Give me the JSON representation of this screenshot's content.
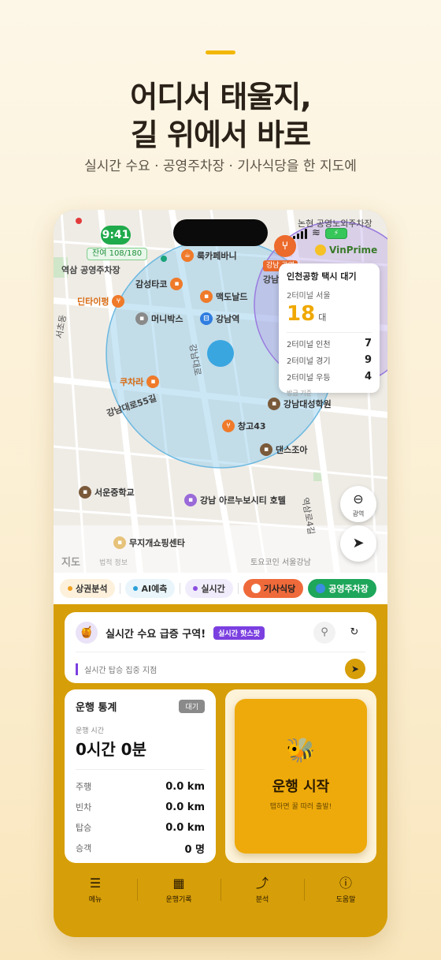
{
  "hero": {
    "title_line1": "어디서 태울지,",
    "title_line2": "길 위에서 바로",
    "subtitle": "실시간 수요 · 공영주차장 · 기사식당을 한 지도에"
  },
  "status": {
    "time": "9:41",
    "top_right_label": "논현 공영노외주차장",
    "battery_icon": "battery-charging-icon",
    "parking_badge": "잔여 108/180"
  },
  "map": {
    "labels": {
      "yeoksam_parking": "역삼 공영주차장",
      "rook_cafe": "룩카페바니",
      "gamsung_taco": "감성타코",
      "mcdonalds": "맥도날드",
      "dintaifung": "딘타이펑",
      "moneybox": "머니박스",
      "gangnam_station": "강남역",
      "gangnam_daero": "강남대로",
      "kucharra": "쿠차라",
      "gangnam_daero_55": "강남대로55길",
      "changgo43": "창고43",
      "dance_jo": "댄스조아",
      "gangnam_academy": "강남대성학원",
      "seoun_middle": "서운중학교",
      "arunuvo": "강남 아르누보시티 호텔",
      "mujigae": "무지개쇼핑센타",
      "vinprime": "VinPrime",
      "gangnam_partial": "강남",
      "red_tag": "강남 공영",
      "yeoksam_ro": "역삼로4길",
      "seocho": "서초동",
      "toyocoin": "토요코인 서울강남"
    },
    "apple_maps": "지도",
    "legal": "법적 정보",
    "zoom_label": "광역",
    "taxi_card": {
      "title": "인천공항 택시 대기",
      "terminal_main": "2터미널 서울",
      "count_main": "18",
      "unit": "대",
      "rows": [
        {
          "label": "2터미널 인천",
          "value": "7"
        },
        {
          "label": "2터미널 경기",
          "value": "9"
        },
        {
          "label": "2터미널 우등",
          "value": "4"
        }
      ],
      "footer": "방금 기준"
    }
  },
  "filters": [
    {
      "label": "상권분석",
      "dot": "#f0a020"
    },
    {
      "label": "AI예측",
      "dot": "#2aa0d8"
    },
    {
      "label": "실시간",
      "dot": "#8a4ee0"
    },
    {
      "label": "기사식당",
      "dot": ""
    },
    {
      "label": "공영주차장",
      "dot": ""
    }
  ],
  "hot": {
    "title": "실시간 수요 급증 구역!",
    "badge": "실시간 핫스팟",
    "sub": "실시간 탑승 집중 지점"
  },
  "stats": {
    "title": "운행 통계",
    "badge": "대기",
    "duration_label": "운행 시간",
    "duration_value": "0시간 0분",
    "rows": [
      {
        "label": "주행",
        "value": "0.0 km"
      },
      {
        "label": "빈차",
        "value": "0.0 km"
      },
      {
        "label": "탑승",
        "value": "0.0 km"
      },
      {
        "label": "승객",
        "value": "0 명"
      }
    ]
  },
  "start": {
    "label": "운행 시작",
    "sub": "탭하면 꿀 따러 출발!"
  },
  "nav": [
    {
      "label": "메뉴",
      "icon": "menu-icon"
    },
    {
      "label": "운행기록",
      "icon": "calendar-icon"
    },
    {
      "label": "분석",
      "icon": "chart-icon"
    },
    {
      "label": "도움말",
      "icon": "help-icon"
    }
  ],
  "colors": {
    "accent": "#f2b705",
    "panel": "#d69e08",
    "start_button": "#eeaa0b",
    "hotspot_badge": "#7b3fe0",
    "cafeteria_chip": "#ef6a3a",
    "parking_chip": "#1ea65a"
  }
}
